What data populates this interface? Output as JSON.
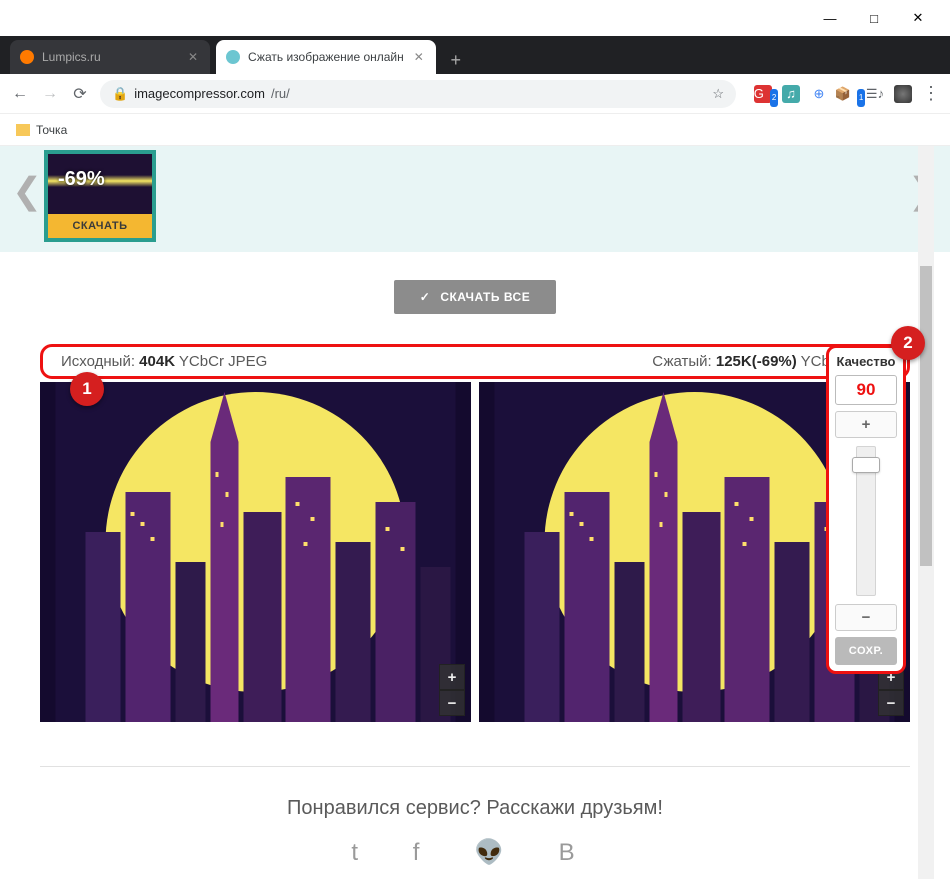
{
  "window": {
    "min": "—",
    "max": "□",
    "close": "✕"
  },
  "tabs": [
    {
      "title": "Lumpics.ru",
      "favicon_bg": "#ff7a00"
    },
    {
      "title": "Сжать изображение онлайн",
      "favicon_bg": "#6cc6d1"
    }
  ],
  "newtab": "+",
  "address": {
    "url_host": "imagecompressor.com",
    "url_path": "/ru/",
    "lock": "🔒",
    "star": "☆"
  },
  "bookmarks": {
    "item1": "Точка"
  },
  "carousel": {
    "badge": "-69%",
    "download_label": "СКАЧАТЬ"
  },
  "download_all": {
    "check": "✓",
    "label": "СКАЧАТЬ ВСЕ"
  },
  "stats": {
    "original_label": "Исходный: ",
    "original_size": "404K",
    "original_info": " YCbCr JPEG",
    "compressed_label": "Сжатый: ",
    "compressed_size": "125K(-69%)",
    "compressed_info": " YCbCr JPEG"
  },
  "callouts": {
    "c1": "1",
    "c2": "2"
  },
  "zoom": {
    "in": "+",
    "out": "−"
  },
  "quality": {
    "title": "Качество",
    "value": "90",
    "plus": "+",
    "minus": "−",
    "save": "СОХР."
  },
  "share": {
    "text": "Понравился сервис? Расскажи друзьям!",
    "icons": "t  f  👽  B"
  }
}
